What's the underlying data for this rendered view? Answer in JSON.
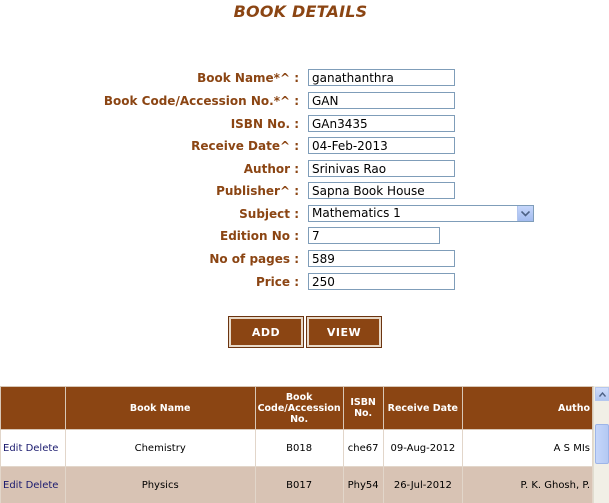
{
  "page": {
    "title": "BOOK DETAILS"
  },
  "form": {
    "book_name": {
      "label": "Book Name*^ :",
      "value": "ganathanthra"
    },
    "book_code": {
      "label": "Book Code/Accession No.*^ :",
      "value": "GAN"
    },
    "isbn": {
      "label": "ISBN No. :",
      "value": "GAn3435"
    },
    "receive_date": {
      "label": "Receive Date^ :",
      "value": "04-Feb-2013"
    },
    "author": {
      "label": "Author :",
      "value": "Srinivas Rao"
    },
    "publisher": {
      "label": "Publisher^ :",
      "value": "Sapna Book House"
    },
    "subject": {
      "label": "Subject :",
      "value": "Mathematics 1"
    },
    "edition": {
      "label": "Edition No :",
      "value": "7"
    },
    "pages": {
      "label": "No of pages :",
      "value": "589"
    },
    "price": {
      "label": "Price :",
      "value": "250"
    }
  },
  "buttons": {
    "add": "ADD",
    "view": "VIEW"
  },
  "grid": {
    "headers": {
      "actions": "",
      "book_name": "Book Name",
      "book_code": "Book Code/Accession No.",
      "isbn": "ISBN No.",
      "receive_date": "Receive Date",
      "author": "Autho"
    },
    "edit_label": "Edit",
    "delete_label": "Delete",
    "rows": [
      {
        "book_name": "Chemistry",
        "book_code": "B018",
        "isbn": "che67",
        "receive_date": "09-Aug-2012",
        "author": "A S MIs"
      },
      {
        "book_name": "Physics",
        "book_code": "B017",
        "isbn": "Phy54",
        "receive_date": "26-Jul-2012",
        "author": "P. K. Ghosh, P."
      }
    ]
  },
  "colors": {
    "accent": "#8B4513",
    "row_alt": "#d8c3b4"
  }
}
